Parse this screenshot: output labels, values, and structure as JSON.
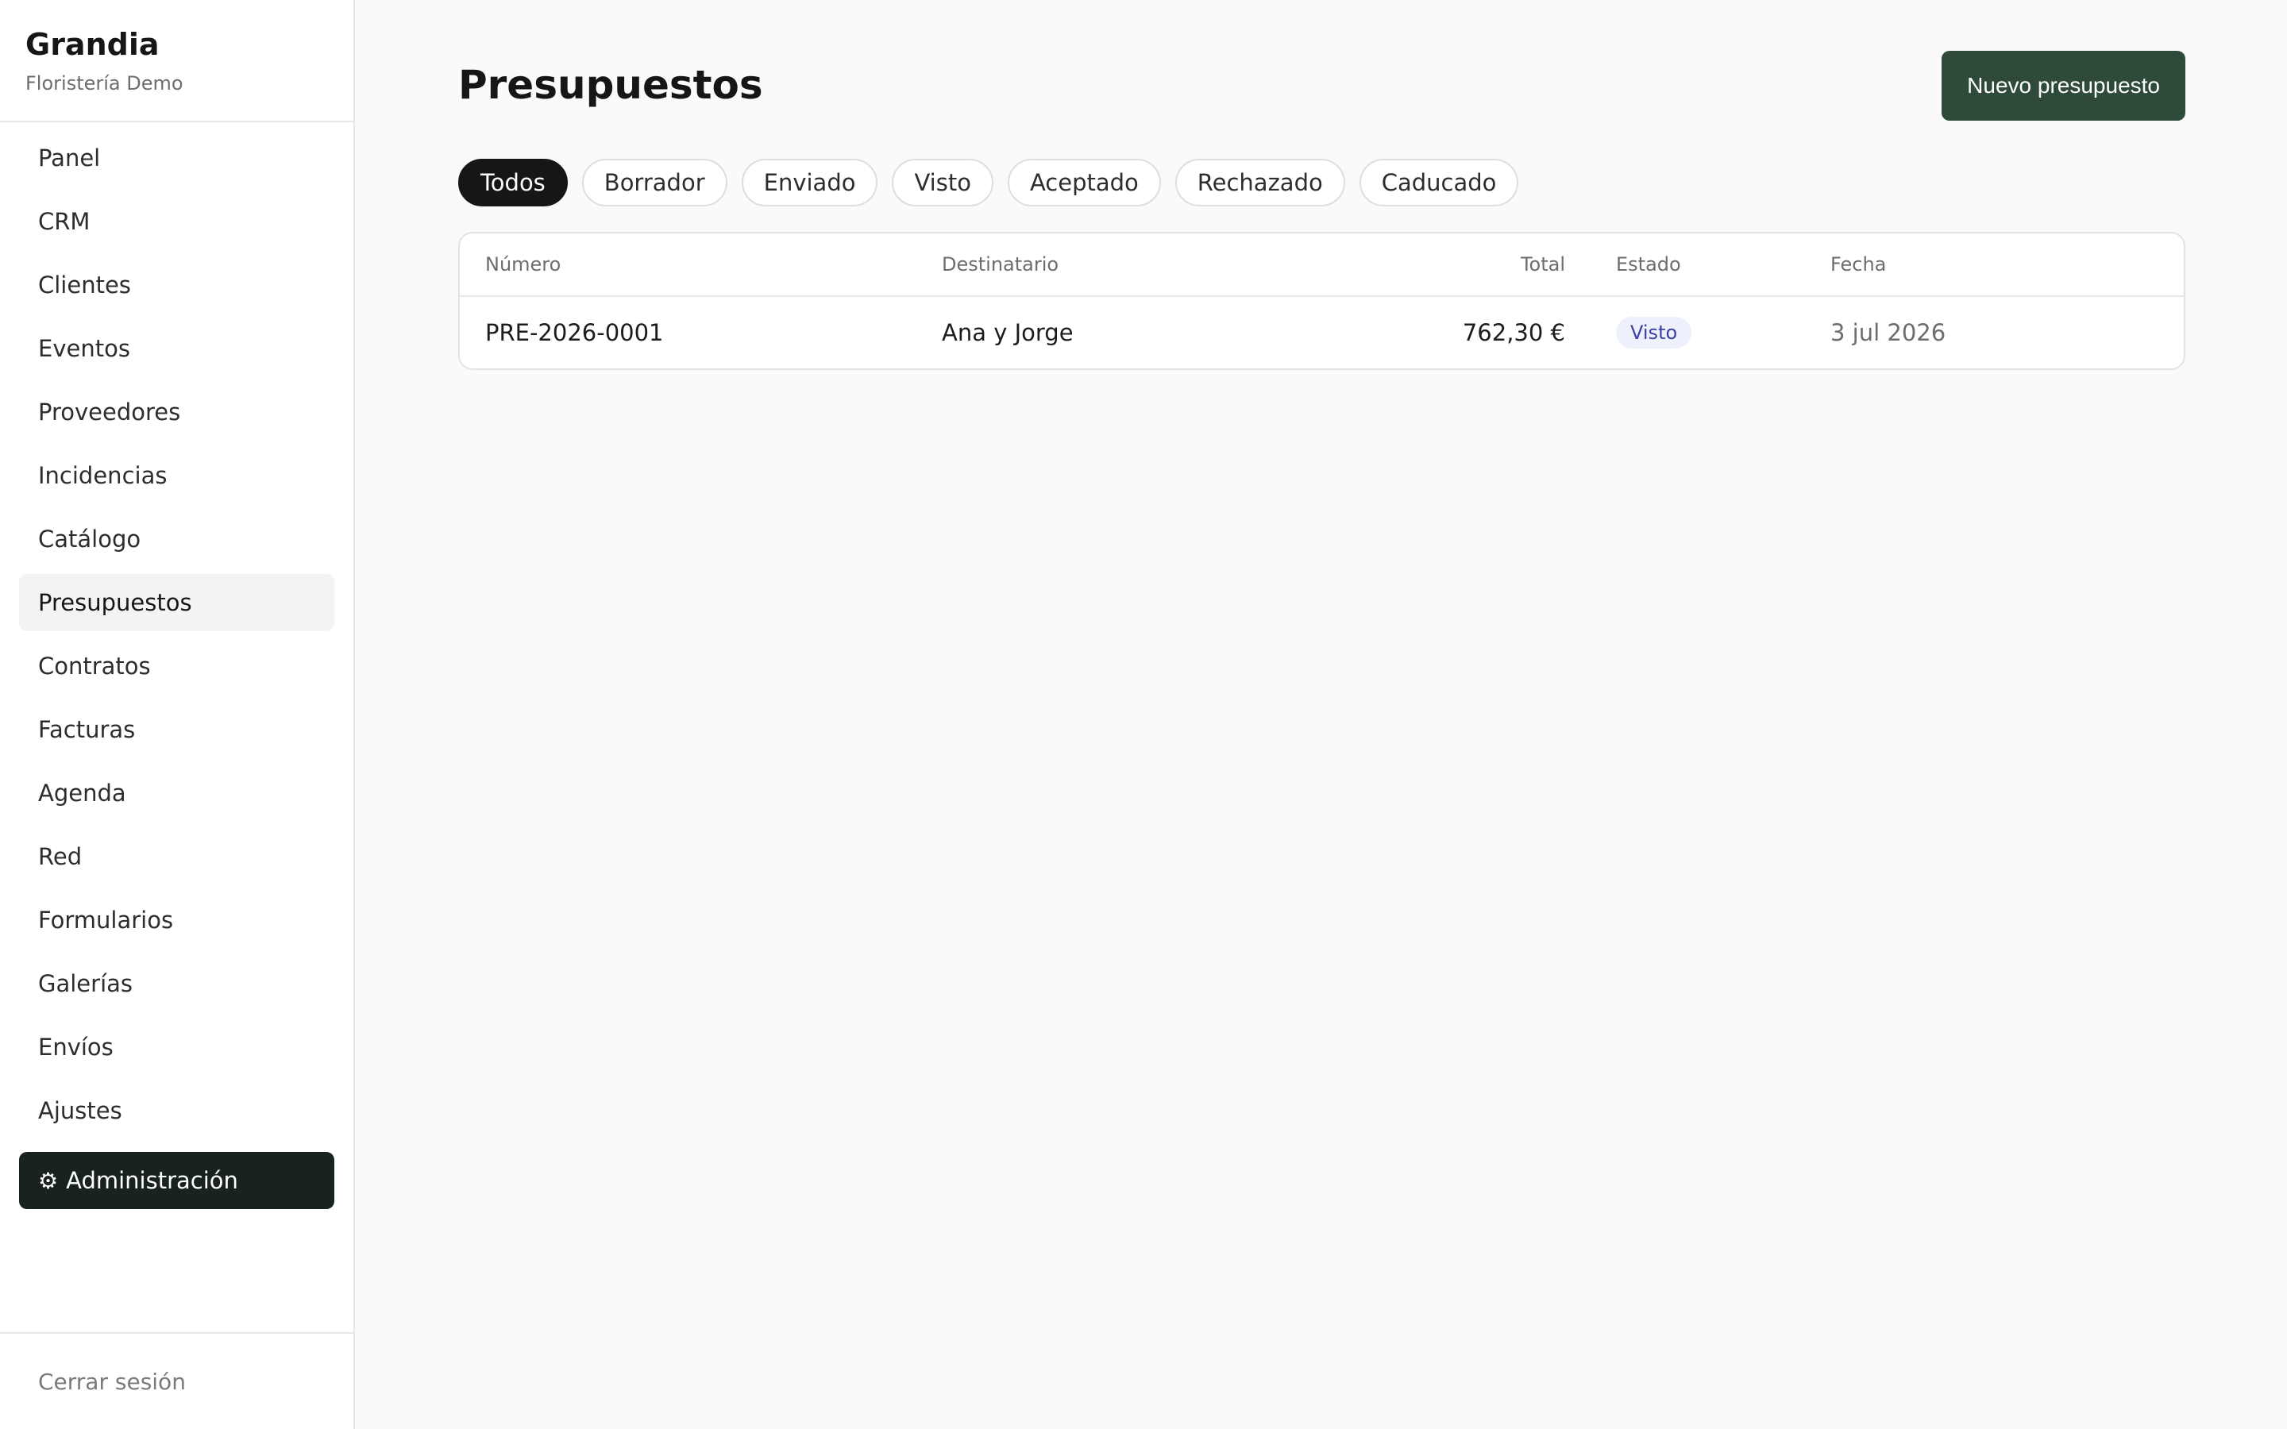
{
  "brand": {
    "name": "Grandia",
    "subtitle": "Floristería Demo"
  },
  "nav": {
    "items": [
      {
        "label": "Panel"
      },
      {
        "label": "CRM"
      },
      {
        "label": "Clientes"
      },
      {
        "label": "Eventos"
      },
      {
        "label": "Proveedores"
      },
      {
        "label": "Incidencias"
      },
      {
        "label": "Catálogo"
      },
      {
        "label": "Presupuestos",
        "active": true
      },
      {
        "label": "Contratos"
      },
      {
        "label": "Facturas"
      },
      {
        "label": "Agenda"
      },
      {
        "label": "Red"
      },
      {
        "label": "Formularios"
      },
      {
        "label": "Galerías"
      },
      {
        "label": "Envíos"
      },
      {
        "label": "Ajustes"
      }
    ],
    "admin": {
      "icon": "⚙",
      "icon_name": "gear-icon",
      "label": "Administración"
    },
    "logout": "Cerrar sesión"
  },
  "page": {
    "title": "Presupuestos",
    "new_button": "Nuevo presupuesto"
  },
  "filters": [
    {
      "label": "Todos",
      "active": true
    },
    {
      "label": "Borrador"
    },
    {
      "label": "Enviado"
    },
    {
      "label": "Visto"
    },
    {
      "label": "Aceptado"
    },
    {
      "label": "Rechazado"
    },
    {
      "label": "Caducado"
    }
  ],
  "table": {
    "headers": {
      "numero": "Número",
      "destinatario": "Destinatario",
      "total": "Total",
      "estado": "Estado",
      "fecha": "Fecha"
    },
    "rows": [
      {
        "numero": "PRE-2026-0001",
        "destinatario": "Ana y Jorge",
        "total": "762,30 €",
        "estado": "Visto",
        "fecha": "3 jul 2026"
      }
    ]
  },
  "colors": {
    "primary_button": "#2e4a39",
    "admin_button": "#17231c",
    "active_chip": "#161616",
    "badge_bg": "#eef0fb",
    "badge_text": "#3b3fa5"
  }
}
